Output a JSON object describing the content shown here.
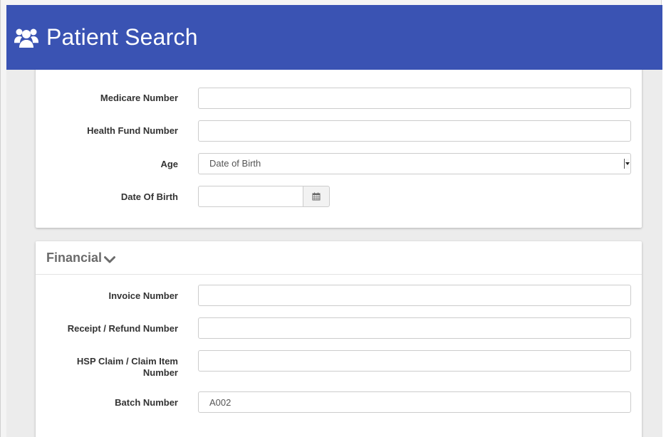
{
  "header": {
    "title": "Patient Search",
    "icon": "users-icon"
  },
  "identifiers_section": {
    "fields": {
      "medicare_number": {
        "label": "Medicare Number",
        "value": ""
      },
      "health_fund_number": {
        "label": "Health Fund Number",
        "value": ""
      },
      "age": {
        "label": "Age",
        "selected": "Date of Birth"
      },
      "date_of_birth": {
        "label": "Date Of Birth",
        "value": "",
        "icon": "calendar-icon"
      }
    }
  },
  "financial_section": {
    "title": "Financial",
    "toggle_icon": "chevron-down-icon",
    "fields": {
      "invoice_number": {
        "label": "Invoice Number",
        "value": ""
      },
      "receipt_refund_number": {
        "label": "Receipt / Refund Number",
        "value": ""
      },
      "hsp_claim_item_number": {
        "label": "HSP Claim / Claim Item Number",
        "value": ""
      },
      "batch_number": {
        "label": "Batch Number",
        "value": "A002"
      }
    }
  },
  "colors": {
    "header_bg": "#3a53b3",
    "header_text": "#ffffff",
    "page_bg": "#ececec"
  }
}
